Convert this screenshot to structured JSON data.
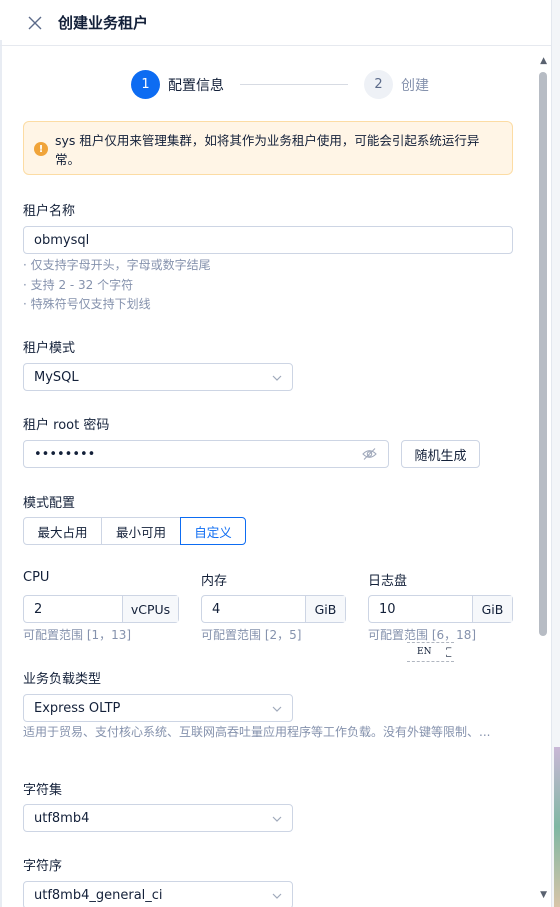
{
  "header": {
    "title": "创建业务租户"
  },
  "steps": [
    {
      "num": "1",
      "label": "配置信息"
    },
    {
      "num": "2",
      "label": "创建"
    }
  ],
  "alert": {
    "icon": "!",
    "text": "sys 租户仅用来管理集群，如将其作为业务租户使用，可能会引起系统运行异常。"
  },
  "tenant_name": {
    "label": "租户名称",
    "value": "obmysql",
    "hints": [
      "· 仅支持字母开头，字母或数字结尾",
      "· 支持 2 - 32 个字符",
      "· 特殊符号仅支持下划线"
    ]
  },
  "tenant_mode": {
    "label": "租户模式",
    "value": "MySQL"
  },
  "root_password": {
    "label": "租户 root 密码",
    "value": "••••••••",
    "generate_label": "随机生成"
  },
  "mode_config": {
    "label": "模式配置",
    "options": [
      "最大占用",
      "最小可用",
      "自定义"
    ],
    "selected": 2
  },
  "resources": {
    "cpu": {
      "label": "CPU",
      "value": "2",
      "unit": "vCPUs",
      "range": "可配置范围 [1，13]"
    },
    "memory": {
      "label": "内存",
      "value": "4",
      "unit": "GiB",
      "range": "可配置范围 [2，5]"
    },
    "log_disk": {
      "label": "日志盘",
      "value": "10",
      "unit": "GiB",
      "range": "可配置范围 [6，18]"
    }
  },
  "ime": {
    "text": "EN"
  },
  "workload": {
    "label": "业务负载类型",
    "value": "Express OLTP",
    "description": "适用于贸易、支付核心系统、互联网高吞吐量应用程序等工作负载。没有外键等限制、..."
  },
  "charset": {
    "label": "字符集",
    "value": "utf8mb4"
  },
  "collation": {
    "label": "字符序",
    "value": "utf8mb4_general_ci"
  },
  "colors": {
    "primary": "#0d6cf2",
    "warning_bg": "#fff5e6",
    "warning_icon": "#f0a43a"
  }
}
